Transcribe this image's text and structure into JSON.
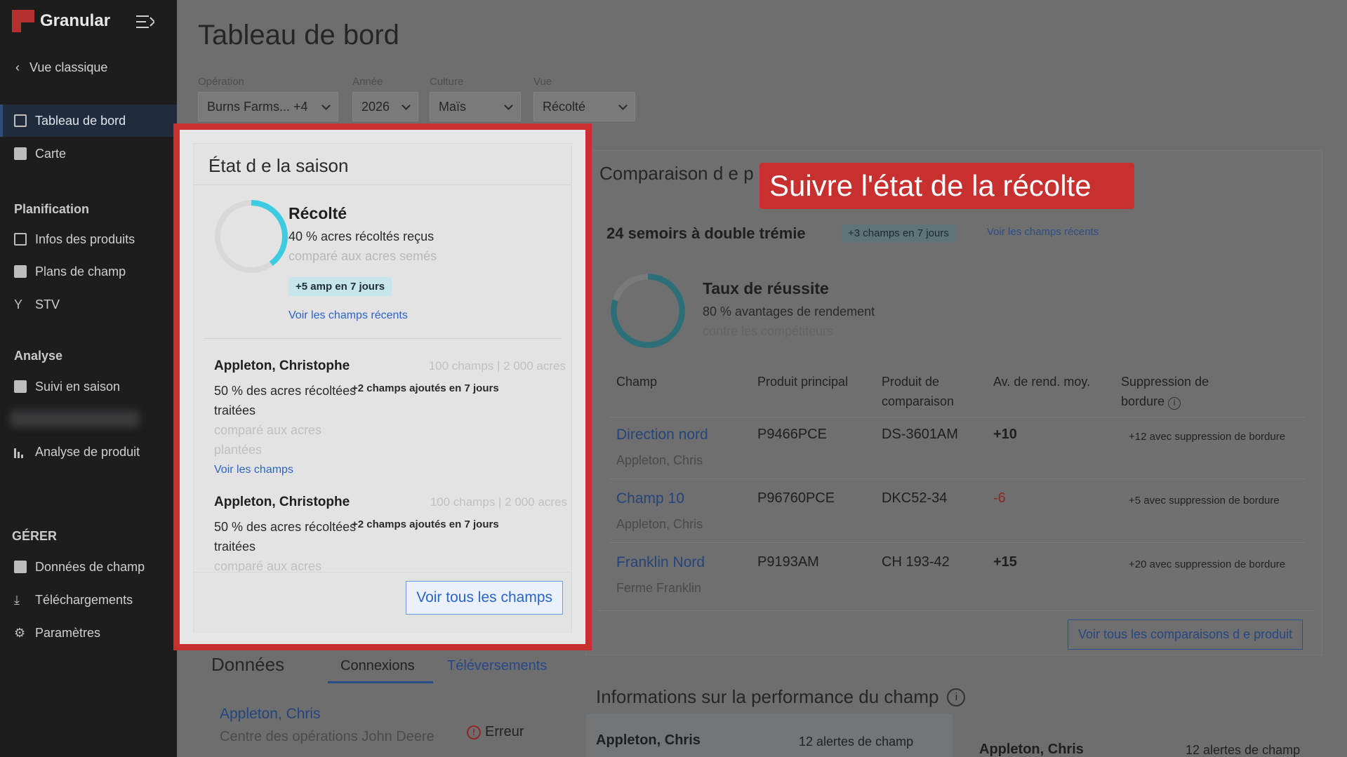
{
  "app": {
    "name": "Granular"
  },
  "sidebar": {
    "back_label": "Vue classique",
    "primary": [
      {
        "label": "Tableau de bord",
        "icon": "dashboard-icon",
        "active": true
      },
      {
        "label": "Carte",
        "icon": "map-icon"
      }
    ],
    "sections": [
      {
        "title": "Planification",
        "items": [
          "Infos des produits",
          "Plans de champ",
          "STV"
        ]
      },
      {
        "title": "Analyse",
        "items": [
          "Suivi en saison",
          "Analyse de produit"
        ]
      },
      {
        "title": "GÉRER",
        "items": [
          "Données de champ",
          "Téléchargements",
          "Paramètres"
        ]
      }
    ]
  },
  "header": {
    "title": "Tableau de bord"
  },
  "filters": [
    {
      "label": "Opération",
      "value": "Burns Farms... +4"
    },
    {
      "label": "Année",
      "value": "2026"
    },
    {
      "label": "Culture",
      "value": "Maïs"
    },
    {
      "label": "Vue",
      "value": "Récolté"
    }
  ],
  "season_card": {
    "title": "État d e la saison",
    "progress_fraction": 0.4,
    "status": "Récolté",
    "line1": "40 % acres récoltés reçus",
    "line2": "comparé aux acres semés",
    "chip": "+5 amp en 7 jours",
    "link": "Voir les champs récents",
    "growers": [
      {
        "name": "Appleton, Christophe",
        "meta": "100 champs | 2 000 acres",
        "desc": "50 % des acres récoltées traitées",
        "compare": "comparé aux acres plantées",
        "added": "+2 champs ajoutés en 7 jours",
        "link": "Voir les champs"
      },
      {
        "name": "Appleton, Christophe",
        "meta": "100 champs | 2 000 acres",
        "desc": "50 % des acres récoltées traitées",
        "compare": "comparé aux acres",
        "added": "+2 champs ajoutés en 7 jours"
      }
    ],
    "button": "Voir tous les champs"
  },
  "callout": "Suivre l'état de la récolte",
  "comparison_card": {
    "title": "Comparaison d e p",
    "subtitle": "24 semoirs à double trémie",
    "chip": "+3 champs en 7 jours",
    "link": "Voir les champs récents",
    "progress_fraction": 0.8,
    "status": "Taux de réussite",
    "line1": "80 % avantages de rendement",
    "line2": "contre les compétiteurs",
    "columns": [
      "Champ",
      "Produit principal",
      "Produit de comparaison",
      "Av. de rend. moy.",
      "Suppression de bordure"
    ],
    "rows": [
      {
        "field": "Direction nord",
        "owner": "Appleton, Chris",
        "main": "P9466PCE",
        "compare": "DS-3601AM",
        "adv": "+10",
        "note": "+12 avec suppression de bordure"
      },
      {
        "field": "Champ 10",
        "owner": "Appleton, Chris",
        "main": "P96760PCE",
        "compare": "DKC52-34",
        "adv": "-6",
        "note": "+5 avec suppression de bordure"
      },
      {
        "field": "Franklin Nord",
        "owner": "Ferme Franklin",
        "main": "P9193AM",
        "compare": "CH 193-42",
        "adv": "+15",
        "note": "+20 avec suppression de bordure"
      }
    ],
    "button": "Voir tous les comparaisons d e produit"
  },
  "data_section": {
    "title": "Données",
    "tabs": [
      "Connexions",
      "Téléversements"
    ],
    "item_name": "Appleton, Chris",
    "item_sub": "Centre des opérations John Deere",
    "item_status": "Erreur"
  },
  "performance_section": {
    "title": "Informations sur la performance du champ",
    "cards": [
      {
        "name": "Appleton, Chris",
        "alerts": "12 alertes de champ"
      },
      {
        "name": "Appleton, Chris",
        "alerts": "12 alertes de champ"
      }
    ]
  }
}
